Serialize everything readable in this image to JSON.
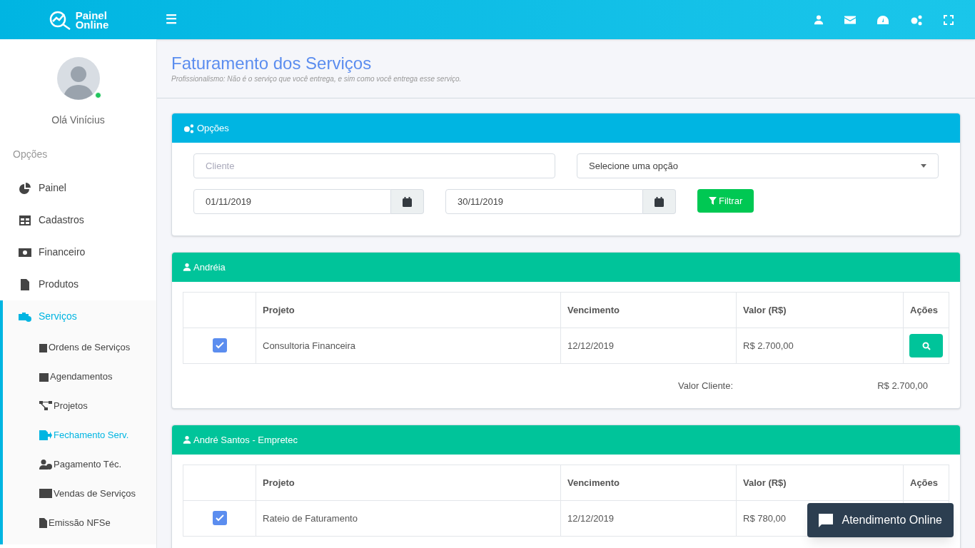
{
  "header": {
    "logo_line1": "Painel",
    "logo_line2": "Online",
    "menu_glyph": "☰"
  },
  "sidebar": {
    "greeting": "Olá Vinícius",
    "online": true,
    "section_label": "Opções",
    "items": [
      {
        "label": "Painel",
        "selected": false,
        "expanded": false
      },
      {
        "label": "Cadastros",
        "selected": false,
        "expanded": false
      },
      {
        "label": "Financeiro",
        "selected": false,
        "expanded": false
      },
      {
        "label": "Produtos",
        "selected": false,
        "expanded": false
      },
      {
        "label": "Serviços",
        "selected": true,
        "expanded": true,
        "children": [
          {
            "label": "Ordens de Serviços",
            "selected": false
          },
          {
            "label": "Agendamentos",
            "selected": false
          },
          {
            "label": "Projetos",
            "selected": false
          },
          {
            "label": "Fechamento Serv.",
            "selected": true
          },
          {
            "label": "Pagamento Téc.",
            "selected": false
          },
          {
            "label": "Vendas de Serviços",
            "selected": false
          },
          {
            "label": "Emissão NFSe",
            "selected": false
          }
        ]
      }
    ]
  },
  "page": {
    "title": "Faturamento dos Serviços",
    "subtitle": "Profissionalismo: Não é o serviço que você entrega, e sim como você entrega esse serviço."
  },
  "options_panel": {
    "title": "Opções",
    "client_placeholder": "Cliente",
    "select_value": "Selecione uma opção",
    "date_from": "01/11/2019",
    "date_to": "30/11/2019",
    "filter_button": "Filtrar"
  },
  "clients": [
    {
      "name": "Andréia",
      "columns": [
        "",
        "Projeto",
        "Vencimento",
        "Valor (R$)",
        "Ações"
      ],
      "rows": [
        {
          "checked": true,
          "project": "Consultoria Financeira",
          "due": "12/12/2019",
          "value": "R$ 2.700,00"
        }
      ],
      "total_label": "Valor Cliente:",
      "total_value": "R$ 2.700,00"
    },
    {
      "name": "André Santos - Empretec",
      "columns": [
        "",
        "Projeto",
        "Vencimento",
        "Valor (R$)",
        "Ações"
      ],
      "rows": [
        {
          "checked": true,
          "project": "Rateio de Faturamento",
          "due": "12/12/2019",
          "value": "R$ 780,00"
        }
      ]
    }
  ],
  "chat_button": "Atendimento Online"
}
